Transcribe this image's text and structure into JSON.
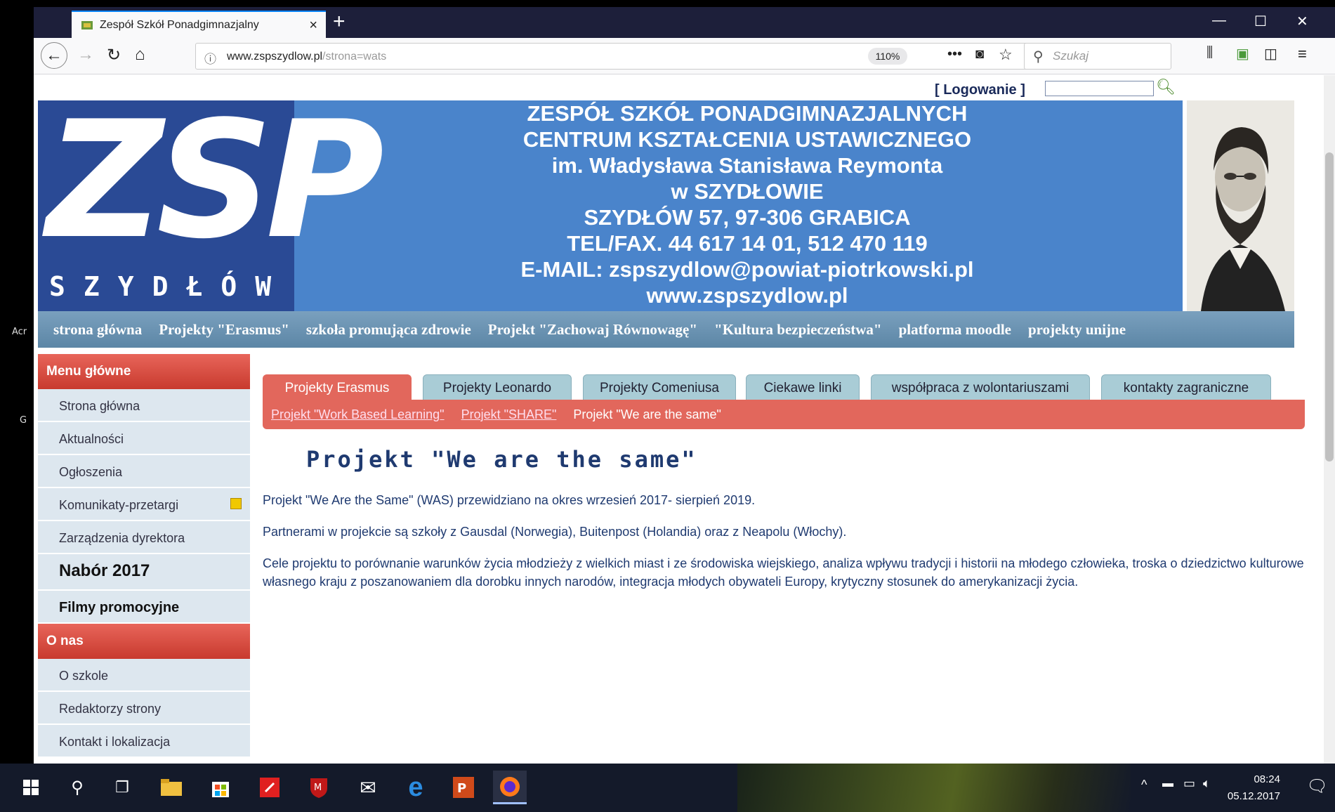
{
  "desktop": {
    "left_text_1": "Acr",
    "left_text_2": "G"
  },
  "browser": {
    "tab_title": "Zespół Szkół Ponadgimnazjalny",
    "url_domain": "www.zspszydlow.pl",
    "url_path": "/strona=wats",
    "zoom": "110%",
    "search_placeholder": "Szukaj"
  },
  "page": {
    "login_label": "[ Logowanie ]",
    "logo": {
      "big": "ZSP",
      "small": "SZYDŁÓW"
    },
    "header_lines": [
      "ZESPÓŁ SZKÓŁ PONADGIMNAZJALNYCH",
      "CENTRUM KSZTAŁCENIA USTAWICZNEGO",
      "im. Władysława Stanisława Reymonta",
      "w SZYDŁOWIE",
      "SZYDŁÓW 57, 97-306 GRABICA",
      "TEL/FAX. 44 617 14 01, 512 470 119",
      "E-MAIL: zspszydlow@powiat-piotrkowski.pl",
      "www.zspszydlow.pl"
    ],
    "top_menu": [
      "strona główna",
      "Projekty \"Erasmus\"",
      "szkoła promująca zdrowie",
      "Projekt \"Zachowaj Równowagę\"",
      "\"Kultura bezpieczeństwa\"",
      "platforma moodle",
      "projekty unijne"
    ],
    "sidebar": {
      "menu_head": "Menu główne",
      "menu_items": [
        "Strona główna",
        "Aktualności",
        "Ogłoszenia",
        "Komunikaty-przetargi",
        "Zarządzenia dyrektora",
        "Nabór 2017",
        "Filmy promocyjne"
      ],
      "about_head": "O nas",
      "about_items": [
        "O szkole",
        "Redaktorzy strony",
        "Kontakt i lokalizacja"
      ]
    },
    "tabs": [
      "Projekty Erasmus",
      "Projekty Leonardo",
      "Projekty Comeniusa",
      "Ciekawe linki",
      "współpraca z wolontariuszami",
      "kontakty zagraniczne"
    ],
    "subtabs": {
      "links": [
        "Projekt \"Work Based Learning\"",
        "Projekt \"SHARE\""
      ],
      "current": "Projekt \"We are the same\""
    },
    "content": {
      "title": "Projekt \"We are the same\"",
      "paragraphs": [
        "Projekt \"We Are the Same\" (WAS) przewidziano na okres wrzesień 2017- sierpień 2019.",
        "Partnerami w projekcie są szkoły z Gausdal (Norwegia), Buitenpost (Holandia) oraz z Neapolu (Włochy).",
        "Cele projektu to porównanie warunków życia młodzieży z wielkich miast i ze środowiska wiejskiego, analiza wpływu tradycji i historii na młodego człowieka, troska o dziedzictwo kulturowe własnego kraju z poszanowaniem dla dorobku innych narodów, integracja młodych obywateli Europy, krytyczny stosunek do amerykanizacji życia."
      ]
    }
  },
  "taskbar": {
    "clock_time": "08:24",
    "clock_date": "05.12.2017",
    "colors": {
      "accent": "#0a84ff",
      "header_blue": "#4a84cb",
      "menu_red": "#e2675c"
    }
  }
}
